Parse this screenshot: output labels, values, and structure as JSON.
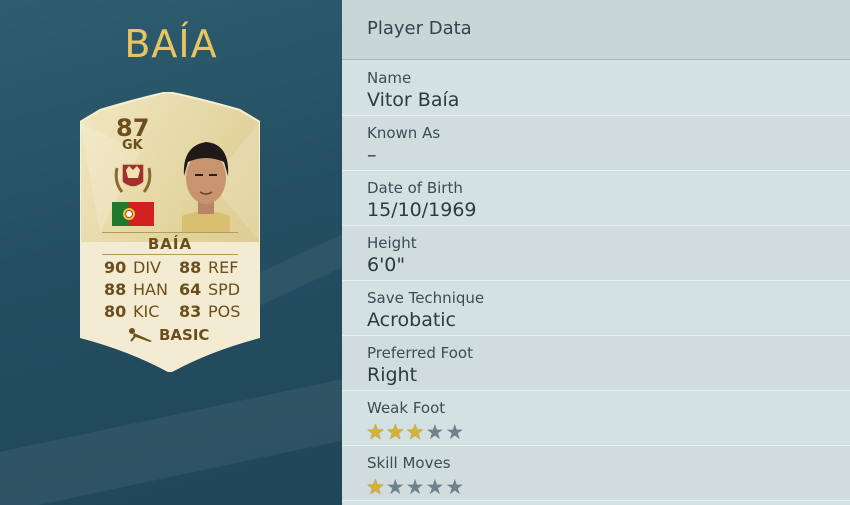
{
  "player": {
    "title": "BAÍA",
    "card": {
      "rating": "87",
      "position": "GK",
      "name": "BAÍA",
      "card_type": "BASIC",
      "stats": [
        [
          {
            "value": "90",
            "label": "DIV"
          },
          {
            "value": "88",
            "label": "REF"
          }
        ],
        [
          {
            "value": "88",
            "label": "HAN"
          },
          {
            "value": "64",
            "label": "SPD"
          }
        ],
        [
          {
            "value": "80",
            "label": "KIC"
          },
          {
            "value": "83",
            "label": "POS"
          }
        ]
      ],
      "card_color": "#e8dcae"
    }
  },
  "panel": {
    "header": "Player Data",
    "fields": [
      {
        "label": "Name",
        "value": "Vitor Baía"
      },
      {
        "label": "Known As",
        "value": "–"
      },
      {
        "label": "Date of Birth",
        "value": "15/10/1969"
      },
      {
        "label": "Height",
        "value": "6'0\""
      },
      {
        "label": "Save Technique",
        "value": "Acrobatic"
      },
      {
        "label": "Preferred Foot",
        "value": "Right"
      }
    ],
    "weak_foot": {
      "label": "Weak Foot",
      "stars": 3,
      "max": 5
    },
    "skill_moves": {
      "label": "Skill Moves",
      "stars": 1,
      "max": 5
    }
  },
  "colors": {
    "title_gold": "#e9c562",
    "star_on": "#d8b034",
    "star_off": "#6e8289"
  }
}
